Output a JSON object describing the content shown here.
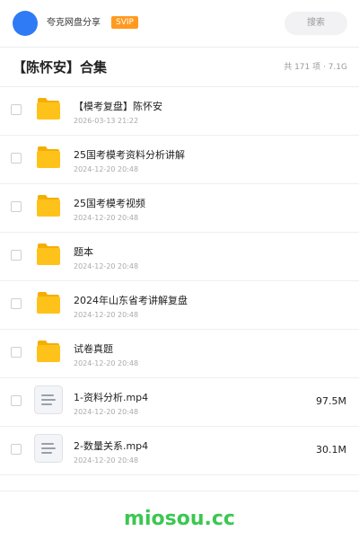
{
  "header": {
    "share_name": "夸克网盘分享",
    "badge": "SVIP",
    "search_label": "搜索",
    "avatar_color": "#2f7bf6"
  },
  "collection": {
    "title": "【陈怀安】合集",
    "summary": "共 171 项 · 7.1G"
  },
  "items": [
    {
      "name": "【模考复盘】陈怀安",
      "date": "2026-03-13 21:22",
      "type": "folder",
      "icon": "folder-icon"
    },
    {
      "name": "25国考模考资料分析讲解",
      "date": "2024-12-20 20:48",
      "type": "folder",
      "icon": "folder-icon"
    },
    {
      "name": "25国考模考视频",
      "date": "2024-12-20 20:48",
      "type": "folder",
      "icon": "folder-icon"
    },
    {
      "name": "题本",
      "date": "2024-12-20 20:48",
      "type": "folder",
      "icon": "folder-icon"
    },
    {
      "name": "2024年山东省考讲解复盘",
      "date": "2024-12-20 20:48",
      "type": "folder",
      "icon": "folder-icon"
    },
    {
      "name": "试卷真题",
      "date": "2024-12-20 20:48",
      "type": "folder",
      "icon": "folder-icon"
    },
    {
      "name": "1-资料分析.mp4",
      "date": "2024-12-20 20:48",
      "type": "file",
      "size": "97.5M",
      "icon": "file-icon"
    },
    {
      "name": "2-数量关系.mp4",
      "date": "2024-12-20 20:48",
      "type": "file",
      "size": "30.1M",
      "icon": "file-icon"
    }
  ],
  "watermark": "miosou.cc",
  "colors": {
    "accent_badge": "#ff9a1f",
    "folder": "#ffc21a",
    "watermark": "#3cc751"
  }
}
